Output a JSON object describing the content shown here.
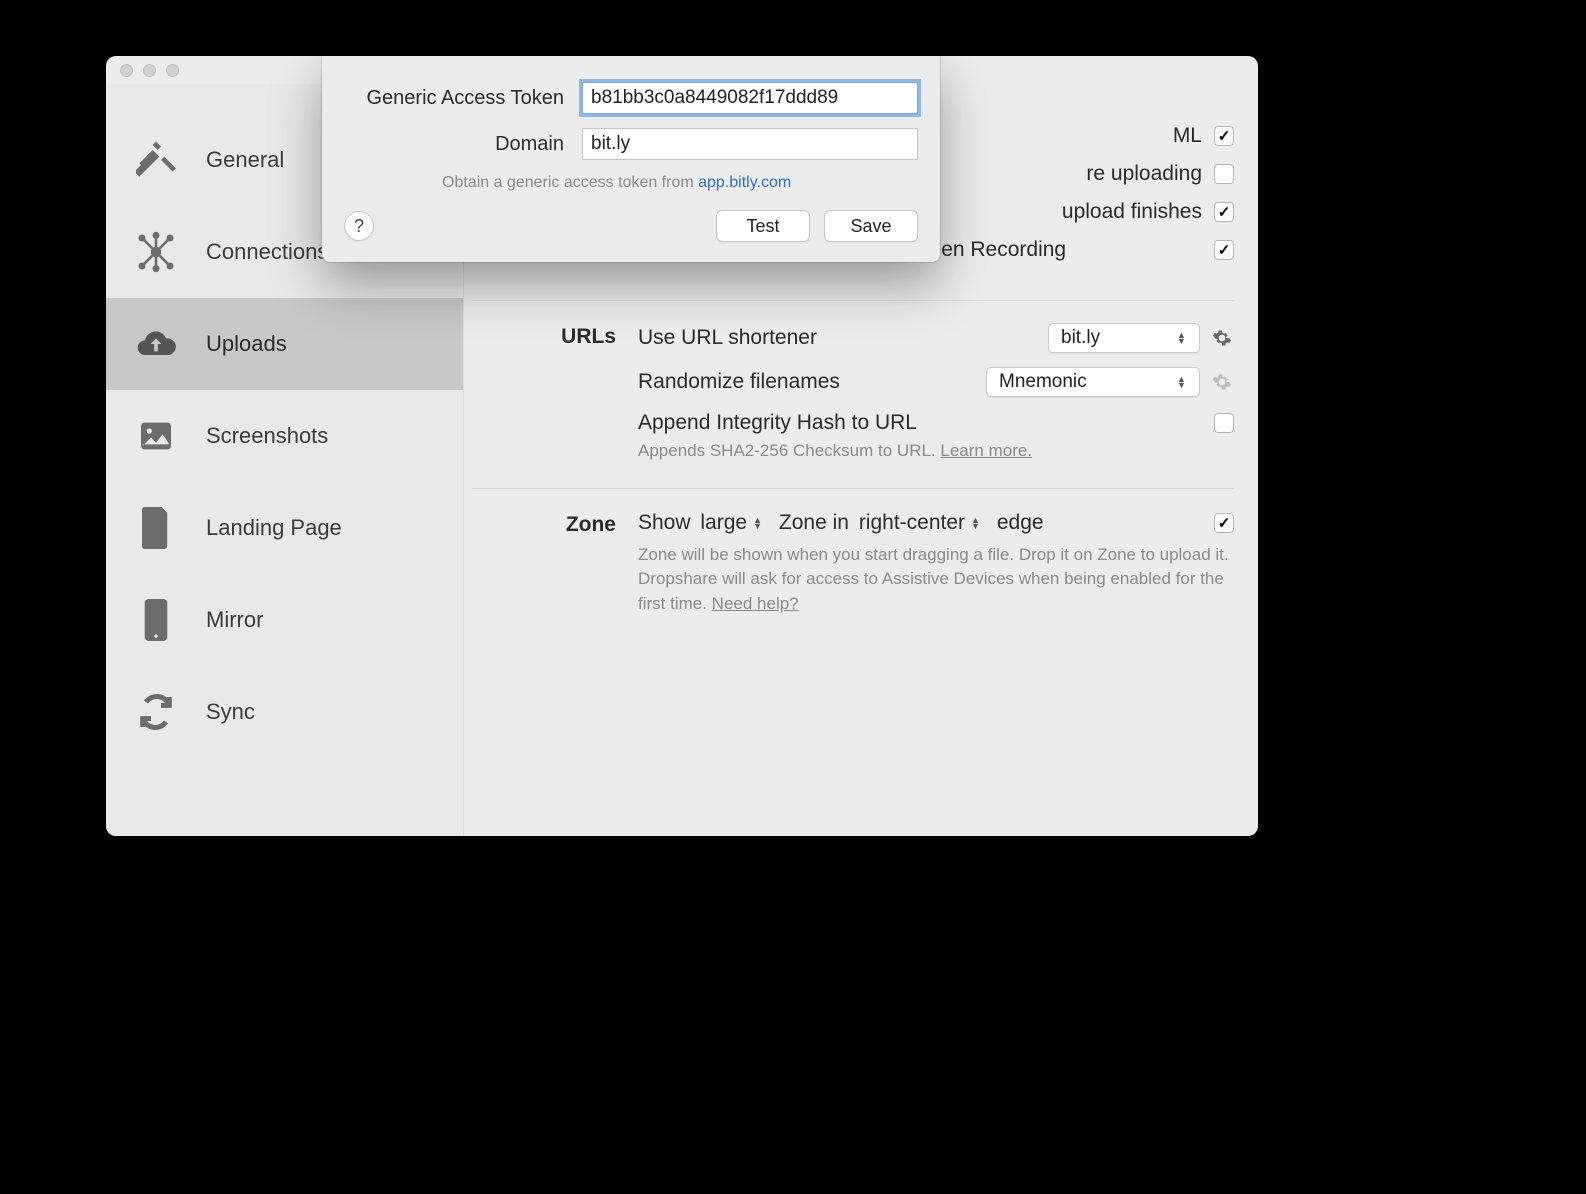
{
  "sidebar": {
    "items": [
      {
        "label": "General"
      },
      {
        "label": "Connections"
      },
      {
        "label": "Uploads"
      },
      {
        "label": "Screenshots"
      },
      {
        "label": "Landing Page"
      },
      {
        "label": "Mirror"
      },
      {
        "label": "Sync"
      }
    ]
  },
  "uploads_section": {
    "row1_suffix": "ML",
    "row2_suffix": "re uploading",
    "row3_suffix": "upload finishes",
    "row4": "Enable \"Do Not Disturb\" for Screen Recording"
  },
  "urls_section": {
    "heading": "URLs",
    "shortener_label": "Use URL shortener",
    "shortener_value": "bit.ly",
    "randomize_label": "Randomize filenames",
    "randomize_value": "Mnemonic",
    "integrity_label": "Append Integrity Hash to URL",
    "integrity_hint_prefix": "Appends SHA2-256 Checksum to URL. ",
    "integrity_hint_link": "Learn more."
  },
  "zone_section": {
    "heading": "Zone",
    "text_show": "Show",
    "size_value": "large",
    "text_zone_in": "Zone in",
    "position_value": "right-center",
    "text_edge": "edge",
    "hint_prefix": "Zone will be shown when you start dragging a file. Drop it on Zone to upload it. Dropshare will ask for access to Assistive Devices when being enabled for the first time. ",
    "hint_link": "Need help?"
  },
  "sheet": {
    "token_label": "Generic Access Token",
    "token_value": "b81bb3c0a8449082f17ddd89",
    "domain_label": "Domain",
    "domain_value": "bit.ly",
    "hint_prefix": "Obtain a generic access token from ",
    "hint_link": "app.bitly.com",
    "help": "?",
    "test": "Test",
    "save": "Save"
  }
}
